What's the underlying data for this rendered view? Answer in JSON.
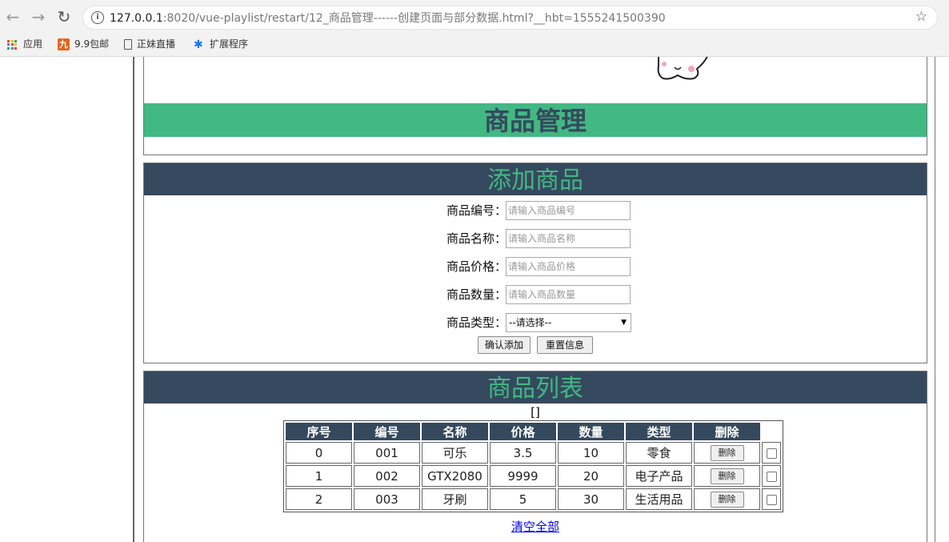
{
  "browser": {
    "url_host": "127.0.0.1",
    "url_rest": ":8020/vue-playlist/restart/12_商品管理------创建页面与部分数据.html?__hbt=1555241500390",
    "bookmarks": [
      {
        "label": "应用",
        "icon": "apps-grid-icon"
      },
      {
        "label": "9.9包邮",
        "icon": "nine-icon"
      },
      {
        "label": "正妹直播",
        "icon": "page-icon"
      },
      {
        "label": "扩展程序",
        "icon": "puzzle-icon"
      }
    ],
    "colors": {
      "chrome": "#f2f2f2"
    }
  },
  "header": {
    "title": "商品管理",
    "colors": {
      "bar": "#42b883",
      "text": "#35495e"
    }
  },
  "add_panel": {
    "title": "添加商品",
    "fields": [
      {
        "label": "商品编号：",
        "placeholder": "请输入商品编号"
      },
      {
        "label": "商品名称：",
        "placeholder": "请输入商品名称"
      },
      {
        "label": "商品价格：",
        "placeholder": "请输入商品价格"
      },
      {
        "label": "商品数量：",
        "placeholder": "请输入商品数量"
      }
    ],
    "type_label": "商品类型：",
    "type_selected": "--请选择--",
    "confirm_label": "确认添加",
    "reset_label": "重置信息"
  },
  "list_panel": {
    "title": "商品列表",
    "debug_text": "[]",
    "columns": [
      "序号",
      "编号",
      "名称",
      "价格",
      "数量",
      "类型",
      "删除"
    ],
    "rows": [
      {
        "index": "0",
        "code": "001",
        "name": "可乐",
        "price": "3.5",
        "qty": "10",
        "type": "零食",
        "delete": "删除"
      },
      {
        "index": "1",
        "code": "002",
        "name": "GTX2080",
        "price": "9999",
        "qty": "20",
        "type": "电子产品",
        "delete": "删除"
      },
      {
        "index": "2",
        "code": "003",
        "name": "牙刷",
        "price": "5",
        "qty": "30",
        "type": "生活用品",
        "delete": "删除"
      }
    ],
    "clear_label": "清空全部"
  }
}
